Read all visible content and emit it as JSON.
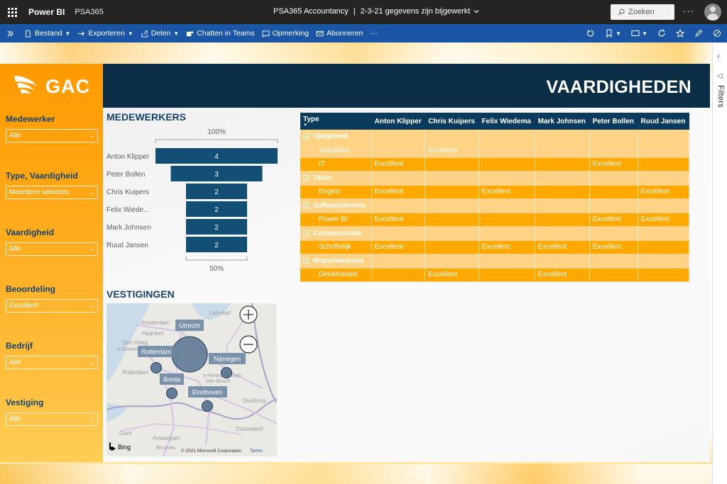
{
  "topbar": {
    "app_name": "Power BI",
    "workspace": "PSA365",
    "report_title": "PSA365 Accountancy",
    "separator": "|",
    "refresh_text": "2-3-21 gegevens zijn bijgewerkt",
    "search_placeholder": "Zoeken"
  },
  "cmdbar": {
    "file": "Bestand",
    "export": "Exporteren",
    "share": "Delen",
    "teams": "Chatten in Teams",
    "comment": "Opmerking",
    "subscribe": "Abonneren"
  },
  "filters_pane": {
    "label": "Filters"
  },
  "report": {
    "logo_text": "GAC",
    "banner_title": "VAARDIGHEDEN",
    "slicers": [
      {
        "title": "Medewerker",
        "value": "Alle"
      },
      {
        "title": "Type, Vaardigheid",
        "value": "Meerdere selecties"
      },
      {
        "title": "Vaardigheid",
        "value": "Alle"
      },
      {
        "title": "Beoordeling",
        "value": "Excellent"
      },
      {
        "title": "Bedrijf",
        "value": "Alle"
      },
      {
        "title": "Vestiging",
        "value": "Alle"
      }
    ]
  },
  "chart_data": {
    "type": "bar",
    "title": "MEDEWERKERS",
    "categories": [
      "Anton Klipper",
      "Peter Bollen",
      "Chris Kuipers",
      "Felix Wiede...",
      "Mark Johnsen",
      "Ruud Jansen"
    ],
    "values": [
      4,
      3,
      2,
      2,
      2,
      2
    ],
    "top_label": "100%",
    "bottom_label": "50%",
    "color": "#134e75"
  },
  "map": {
    "title": "VESTIGINGEN",
    "cities": [
      "Utrecht",
      "Rotterdam",
      "Nijmegen",
      "Breda",
      "Eindhoven"
    ],
    "background_places": [
      "Lelystad",
      "Amsterdam",
      "Haarlem",
      "Den Haag",
      "'s-Gravenhage",
      "Rotterdam",
      "Antwerpen",
      "Duisburg",
      "Düsseldorf",
      "Gent",
      "Brussels",
      "'s-Hertogenbosch",
      "Den Bosch"
    ],
    "provider": "Bing",
    "copyright": "© 2021 Microsoft Corporation",
    "terms": "Terms"
  },
  "matrix": {
    "headers": [
      "Type",
      "Anton Klipper",
      "Chris Kuipers",
      "Felix Wiedema",
      "Mark Johnsen",
      "Peter Bollen",
      "Ruud Jansen"
    ],
    "rows": [
      {
        "kind": "cat",
        "label": "Vakgebied",
        "cells": [
          "",
          "",
          "",
          "",
          "",
          ""
        ]
      },
      {
        "kind": "sub",
        "alt": true,
        "label": "Subsidies",
        "cells": [
          "",
          "Excellent",
          "",
          "",
          "",
          ""
        ]
      },
      {
        "kind": "sub",
        "label": "IT",
        "cells": [
          "Excellent",
          "",
          "",
          "",
          "Excellent",
          ""
        ]
      },
      {
        "kind": "cat",
        "label": "Talen",
        "cells": [
          "",
          "",
          "",
          "",
          "",
          ""
        ]
      },
      {
        "kind": "sub",
        "label": "Engels",
        "cells": [
          "Excellent",
          "",
          "Excellent",
          "",
          "",
          "Excellent"
        ]
      },
      {
        "kind": "cat",
        "label": "Softwarekennis",
        "cells": [
          "",
          "",
          "",
          "",
          "",
          ""
        ]
      },
      {
        "kind": "sub",
        "label": "Power BI",
        "cells": [
          "Excellent",
          "",
          "",
          "",
          "Excellent",
          "Excellent"
        ]
      },
      {
        "kind": "cat",
        "label": "Communicatie",
        "cells": [
          "",
          "",
          "",
          "",
          "",
          ""
        ]
      },
      {
        "kind": "sub",
        "label": "Schriftelijk",
        "cells": [
          "Excellent",
          "",
          "Excellent",
          "Excellent",
          "Excellent",
          ""
        ]
      },
      {
        "kind": "cat",
        "label": "Branchekennis",
        "cells": [
          "",
          "",
          "",
          "",
          "",
          ""
        ]
      },
      {
        "kind": "sub",
        "label": "Detailhandel",
        "cells": [
          "",
          "Excellent",
          "",
          "Excellent",
          "",
          ""
        ]
      }
    ]
  }
}
